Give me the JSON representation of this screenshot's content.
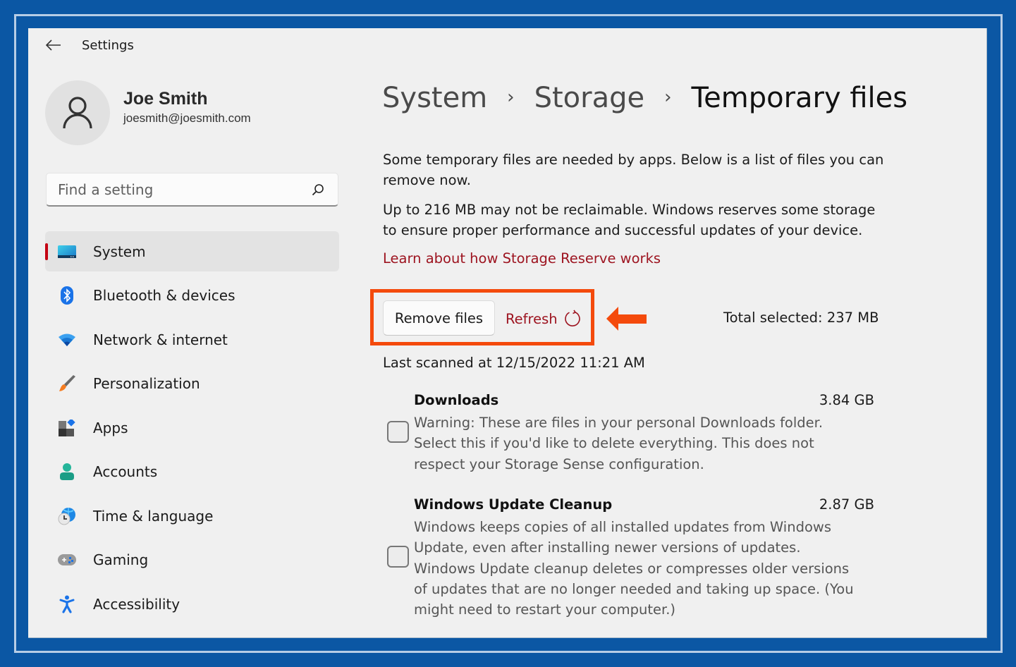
{
  "window": {
    "app_title": "Settings",
    "back_icon": "arrow-left-icon"
  },
  "user": {
    "name": "Joe Smith",
    "email": "joesmith@joesmith.com",
    "avatar_icon": "person-icon"
  },
  "search": {
    "placeholder": "Find a setting",
    "value": "",
    "icon": "search-icon"
  },
  "sidebar": {
    "active_indicator_color": "#c40012",
    "items": [
      {
        "label": "System",
        "icon": "monitor-icon",
        "active": true
      },
      {
        "label": "Bluetooth & devices",
        "icon": "bluetooth-icon",
        "active": false
      },
      {
        "label": "Network & internet",
        "icon": "wifi-icon",
        "active": false
      },
      {
        "label": "Personalization",
        "icon": "paintbrush-icon",
        "active": false
      },
      {
        "label": "Apps",
        "icon": "apps-icon",
        "active": false
      },
      {
        "label": "Accounts",
        "icon": "account-icon",
        "active": false
      },
      {
        "label": "Time & language",
        "icon": "time-language-icon",
        "active": false
      },
      {
        "label": "Gaming",
        "icon": "gamepad-icon",
        "active": false
      },
      {
        "label": "Accessibility",
        "icon": "accessibility-icon",
        "active": false
      }
    ]
  },
  "breadcrumb": {
    "items": [
      "System",
      "Storage",
      "Temporary files"
    ],
    "separator": "›"
  },
  "main": {
    "intro": "Some temporary files are needed by apps. Below is a list of files you can remove now.",
    "reserve_note": "Up to 216 MB may not be reclaimable. Windows reserves some storage to ensure proper performance and successful updates of your device.",
    "learn_link": "Learn about how Storage Reserve works",
    "remove_button": "Remove files",
    "refresh_button": "Refresh",
    "refresh_icon": "refresh-icon",
    "total_selected": "Total selected: 237 MB",
    "last_scanned": "Last scanned at 12/15/2022 11:21 AM",
    "link_color": "#9d1420",
    "files": [
      {
        "name": "Downloads",
        "size": "3.84 GB",
        "checked": false,
        "description": "Warning: These are files in your personal Downloads folder. Select this if you'd like to delete everything. This does not respect your Storage Sense configuration."
      },
      {
        "name": "Windows Update Cleanup",
        "size": "2.87 GB",
        "checked": false,
        "description": "Windows keeps copies of all installed updates from Windows Update, even after installing newer versions of updates. Windows Update cleanup deletes or compresses older versions of updates that are no longer needed and taking up space. (You might need to restart your computer.)"
      }
    ]
  },
  "annotation": {
    "highlight_color": "#f44a0c",
    "arrow_icon": "arrow-left-callout-icon"
  },
  "frame": {
    "border_color": "#0b57a4"
  }
}
